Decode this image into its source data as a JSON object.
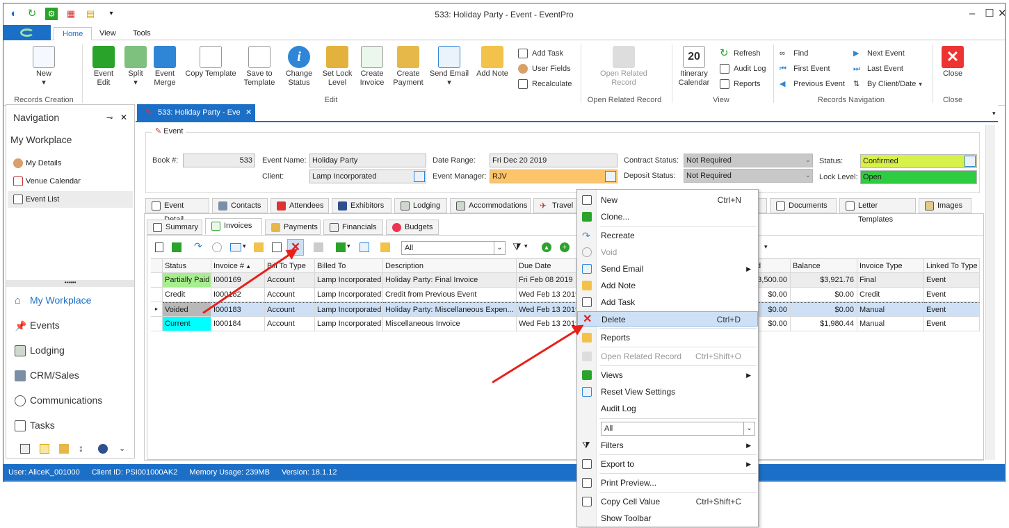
{
  "window": {
    "title": "533: Holiday Party - Event - EventPro"
  },
  "ribbon_tabs": [
    "Home",
    "View",
    "Tools"
  ],
  "ribbon": {
    "new": "New",
    "event_edit": "Event\nEdit",
    "split": "Split",
    "event_merge": "Event\nMerge",
    "copy_template": "Copy Template",
    "save_to_template": "Save to\nTemplate",
    "change_status": "Change\nStatus",
    "set_lock_level": "Set Lock\nLevel",
    "create_invoice": "Create\nInvoice",
    "create_payment": "Create\nPayment",
    "send_email": "Send Email",
    "add_note": "Add Note",
    "add_task": "Add Task",
    "user_fields": "User Fields",
    "recalculate": "Recalculate",
    "open_related_record": "Open Related\nRecord",
    "itinerary_calendar": "Itinerary\nCalendar",
    "refresh": "Refresh",
    "audit_log": "Audit Log",
    "reports": "Reports",
    "find": "Find",
    "first_event": "First Event",
    "previous_event": "Previous Event",
    "next_event": "Next Event",
    "last_event": "Last Event",
    "by_client_date": "By Client/Date",
    "close": "Close",
    "groups": {
      "records_creation": "Records Creation",
      "edit": "Edit",
      "open_related_record": "Open Related Record",
      "view": "View",
      "records_navigation": "Records Navigation",
      "close": "Close"
    }
  },
  "navigation": {
    "header": "Navigation",
    "workplace": "My Workplace",
    "items": [
      "My Details",
      "Venue Calendar",
      "Event List"
    ],
    "big_items": [
      "My Workplace",
      "Events",
      "Lodging",
      "CRM/Sales",
      "Communications",
      "Tasks"
    ]
  },
  "doc_tab": "533: Holiday Party - Eve",
  "event": {
    "section": "Event",
    "book_label": "Book #:",
    "book": "533",
    "event_name_label": "Event Name:",
    "event_name": "Holiday Party",
    "client_label": "Client:",
    "client": "Lamp Incorporated",
    "date_range_label": "Date Range:",
    "date_range": "Fri Dec 20 2019",
    "event_manager_label": "Event Manager:",
    "event_manager": "RJV",
    "contract_status_label": "Contract Status:",
    "contract_status": "Not Required",
    "deposit_status_label": "Deposit Status:",
    "deposit_status": "Not Required",
    "status_label": "Status:",
    "status": "Confirmed",
    "lock_level_label": "Lock Level:",
    "lock_level": "Open"
  },
  "main_tabs": [
    "Event Detail",
    "Contacts",
    "Attendees",
    "Exhibitors",
    "Lodging",
    "Accommodations",
    "Travel",
    "s",
    "Documents",
    "Letter Templates",
    "Images"
  ],
  "sub_tabs": [
    "Summary",
    "Invoices",
    "Payments",
    "Financials",
    "Budgets"
  ],
  "filter_value": "All",
  "grid": {
    "headers": [
      "Status",
      "Invoice #",
      "Bill To Type",
      "Billed To",
      "Description",
      "Due Date",
      "d",
      "Balance",
      "Invoice Type",
      "Linked To Type"
    ],
    "rows": [
      [
        "Partially Paid",
        "I000169",
        "Account",
        "Lamp Incorporated",
        "Holiday Party: Final Invoice",
        "Fri Feb 08 2019",
        "3,500.00",
        "$3,921.76",
        "Final",
        "Event"
      ],
      [
        "Credit",
        "I000182",
        "Account",
        "Lamp Incorporated",
        "Credit from Previous Event",
        "Wed Feb 13 2019",
        "$0.00",
        "$0.00",
        "Credit",
        "Event"
      ],
      [
        "Voided",
        "I000183",
        "Account",
        "Lamp Incorporated",
        "Holiday Party: Miscellaneous Expen...",
        "Wed Feb 13 2019",
        "$0.00",
        "$0.00",
        "Manual",
        "Event"
      ],
      [
        "Current",
        "I000184",
        "Account",
        "Lamp Incorporated",
        "Miscellaneous Invoice",
        "Wed Feb 13 2019",
        "$0.00",
        "$1,980.44",
        "Manual",
        "Event"
      ]
    ]
  },
  "status_bar": {
    "user": "User: AliceK_001000",
    "client_id": "Client ID: PSI001000AK2",
    "memory": "Memory Usage: 239MB",
    "version": "Version: 18.1.12"
  },
  "context_menu": {
    "new": "New",
    "new_sc": "Ctrl+N",
    "clone": "Clone...",
    "recreate": "Recreate",
    "void": "Void",
    "send_email": "Send Email",
    "add_note": "Add Note",
    "add_task": "Add Task",
    "delete": "Delete",
    "delete_sc": "Ctrl+D",
    "reports": "Reports",
    "open_related_record": "Open Related Record",
    "open_related_sc": "Ctrl+Shift+O",
    "views": "Views",
    "reset_view_settings": "Reset View Settings",
    "audit_log": "Audit Log",
    "all": "All",
    "filters": "Filters",
    "export_to": "Export to",
    "print_preview": "Print Preview...",
    "copy_cell_value": "Copy Cell Value",
    "copy_cell_sc": "Ctrl+Shift+C",
    "show_toolbar": "Show Toolbar"
  },
  "colors": {
    "accent": "#1c6fc6",
    "partially_paid": "#a6ee8e",
    "current": "#00ffff",
    "voided": "#b8b8b8",
    "confirmed": "#d8f04a",
    "open": "#2ecc40",
    "manager": "#fdc46a",
    "arrow": "#e8201a"
  }
}
